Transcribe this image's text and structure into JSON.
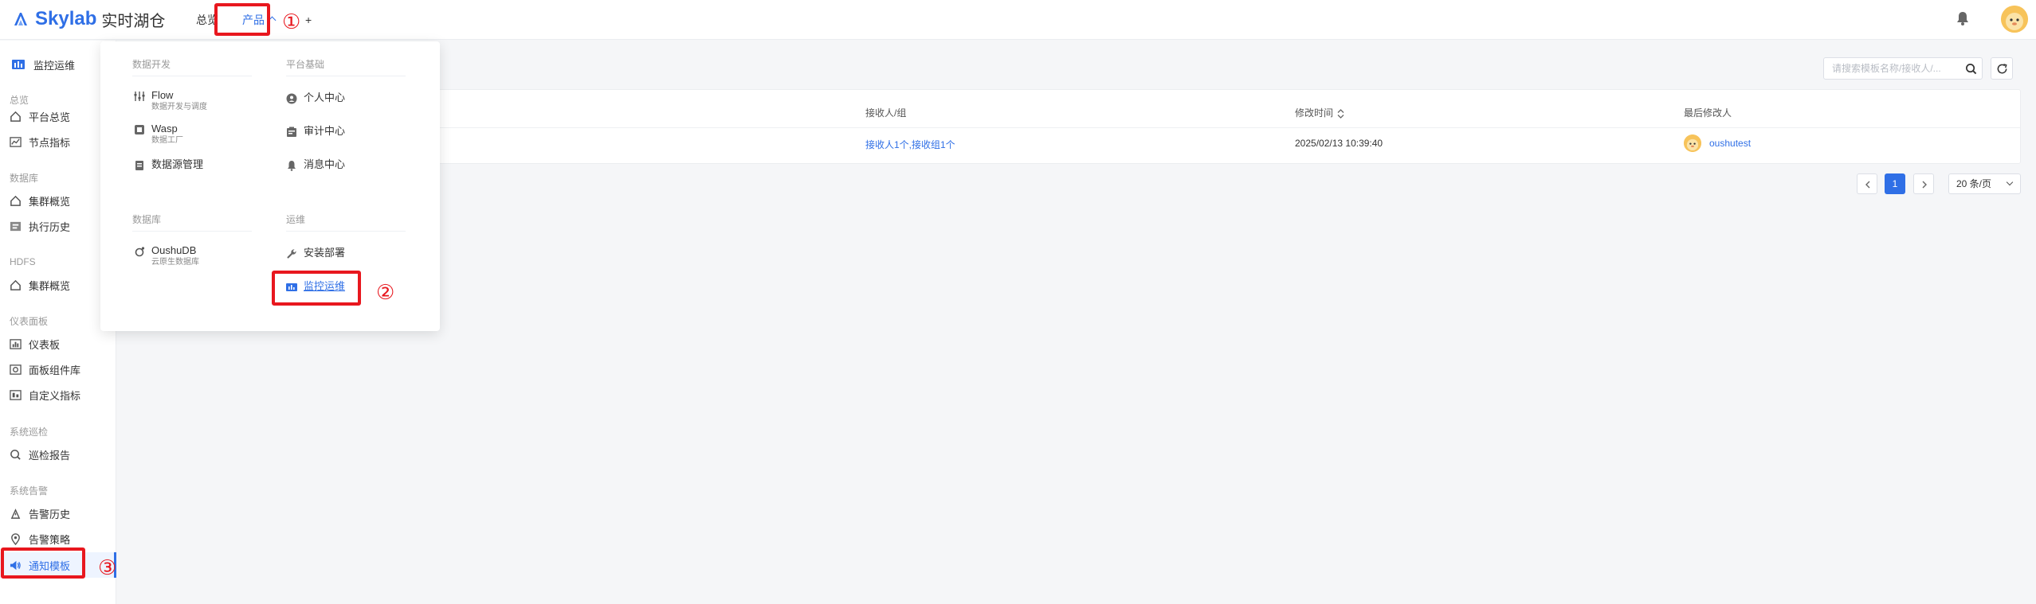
{
  "app": {
    "logo_name": "Skylab",
    "logo_sub": "实时湖仓"
  },
  "topnav": {
    "overview": "总览",
    "product": "产品",
    "plus": "+"
  },
  "sidebar": {
    "head": "监控运维",
    "groups": {
      "overview": "总览",
      "database": "数据库",
      "hdfs": "HDFS",
      "dashboard": "仪表面板",
      "inspection": "系统巡检",
      "alert": "系统告警"
    },
    "items": {
      "platform_overview": "平台总览",
      "node_metrics": "节点指标",
      "cluster_overview": "集群概览",
      "exec_history": "执行历史",
      "hdfs_cluster_overview": "集群概览",
      "dashboard": "仪表板",
      "panel_library": "面板组件库",
      "custom_metrics": "自定义指标",
      "inspection_report": "巡检报告",
      "alert_history": "告警历史",
      "alert_policy": "告警策略",
      "notify_template": "通知模板"
    }
  },
  "dropdown": {
    "groups": {
      "data_dev": "数据开发",
      "platform_base": "平台基础",
      "database": "数据库",
      "ops": "运维"
    },
    "items": {
      "flow": {
        "title": "Flow",
        "desc": "数据开发与调度"
      },
      "wasp": {
        "title": "Wasp",
        "desc": "数据工厂"
      },
      "datasource": {
        "title": "数据源管理"
      },
      "personal": {
        "title": "个人中心"
      },
      "audit": {
        "title": "审计中心"
      },
      "message": {
        "title": "消息中心"
      },
      "oushudb": {
        "title": "OushuDB",
        "desc": "云原生数据库"
      },
      "install": {
        "title": "安装部署"
      },
      "monitor": {
        "title": "监控运维"
      }
    }
  },
  "table": {
    "headers": {
      "receiver": "接收人/组",
      "modified_time": "修改时间",
      "last_modifier": "最后修改人"
    },
    "rows": [
      {
        "receiver": "接收人1个,接收组1个",
        "modified_time": "2025/02/13 10:39:40",
        "last_modifier": "oushutest"
      }
    ]
  },
  "search": {
    "placeholder": "请搜索模板名称/接收人/..."
  },
  "pagination": {
    "current": "1",
    "page_size": "20 条/页"
  },
  "annotations": {
    "one": "①",
    "two": "②",
    "three": "③"
  },
  "colors": {
    "primary": "#2f6fe6",
    "annotation_red": "#e8171e"
  }
}
